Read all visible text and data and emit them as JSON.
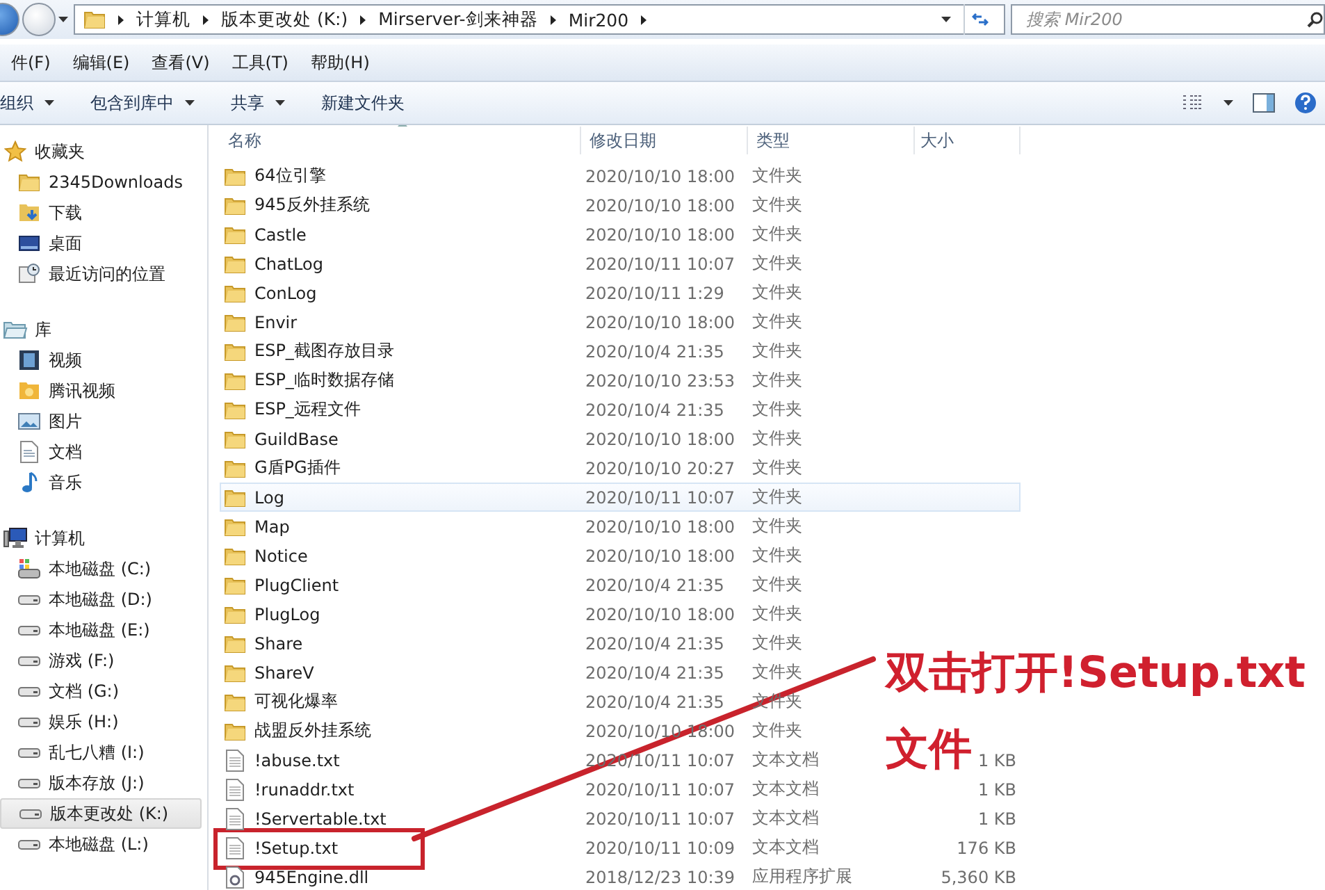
{
  "address_bar": {
    "breadcrumbs": [
      "计算机",
      "版本更改处 (K:)",
      "Mirserver-剑来神器",
      "Mir200"
    ],
    "search": {
      "placeholder": "搜索 Mir200"
    }
  },
  "menu_bar": [
    "件(F)",
    "编辑(E)",
    "查看(V)",
    "工具(T)",
    "帮助(H)"
  ],
  "toolbar": [
    "组织",
    "包含到库中",
    "共享",
    "新建文件夹"
  ],
  "sidebar": [
    {
      "label": "收藏夹",
      "kind": "star",
      "items": [
        {
          "label": "2345Downloads",
          "kind": "folder",
          "selected": false
        },
        {
          "label": "下载",
          "kind": "download",
          "selected": false
        },
        {
          "label": "桌面",
          "kind": "desktop",
          "selected": false
        },
        {
          "label": "最近访问的位置",
          "kind": "recent",
          "selected": false
        }
      ]
    },
    {
      "label": "库",
      "kind": "library",
      "items": [
        {
          "label": "视频",
          "kind": "video",
          "selected": false
        },
        {
          "label": "腾讯视频",
          "kind": "tencent",
          "selected": false
        },
        {
          "label": "图片",
          "kind": "image",
          "selected": false
        },
        {
          "label": "文档",
          "kind": "doc",
          "selected": false
        },
        {
          "label": "音乐",
          "kind": "music",
          "selected": false
        }
      ]
    },
    {
      "label": "计算机",
      "kind": "computer",
      "items": [
        {
          "label": "本地磁盘 (C:)",
          "kind": "sysdrive",
          "selected": false
        },
        {
          "label": "本地磁盘 (D:)",
          "kind": "drive",
          "selected": false
        },
        {
          "label": "本地磁盘 (E:)",
          "kind": "drive",
          "selected": false
        },
        {
          "label": "游戏 (F:)",
          "kind": "drive",
          "selected": false
        },
        {
          "label": "文档 (G:)",
          "kind": "drive",
          "selected": false
        },
        {
          "label": "娱乐 (H:)",
          "kind": "drive",
          "selected": false
        },
        {
          "label": "乱七八糟 (I:)",
          "kind": "drive",
          "selected": false
        },
        {
          "label": "版本存放 (J:)",
          "kind": "drive",
          "selected": false
        },
        {
          "label": "版本更改处 (K:)",
          "kind": "drive",
          "selected": true
        },
        {
          "label": "本地磁盘 (L:)",
          "kind": "drive",
          "selected": false
        }
      ]
    }
  ],
  "table": {
    "columns": [
      "名称",
      "修改日期",
      "类型",
      "大小"
    ],
    "rows": [
      {
        "name": "64位引擎",
        "date": "2020/10/10 18:00",
        "type": "文件夹",
        "kind": "folder",
        "selected": false
      },
      {
        "name": "945反外挂系统",
        "date": "2020/10/10 18:00",
        "type": "文件夹",
        "kind": "folder",
        "selected": false
      },
      {
        "name": "Castle",
        "date": "2020/10/10 18:00",
        "type": "文件夹",
        "kind": "folder",
        "selected": false
      },
      {
        "name": "ChatLog",
        "date": "2020/10/11 10:07",
        "type": "文件夹",
        "kind": "folder",
        "selected": false
      },
      {
        "name": "ConLog",
        "date": "2020/10/11 1:29",
        "type": "文件夹",
        "kind": "folder",
        "selected": false
      },
      {
        "name": "Envir",
        "date": "2020/10/10 18:00",
        "type": "文件夹",
        "kind": "folder",
        "selected": false
      },
      {
        "name": "ESP_截图存放目录",
        "date": "2020/10/4 21:35",
        "type": "文件夹",
        "kind": "folder",
        "selected": false
      },
      {
        "name": "ESP_临时数据存储",
        "date": "2020/10/10 23:53",
        "type": "文件夹",
        "kind": "folder",
        "selected": false
      },
      {
        "name": "ESP_远程文件",
        "date": "2020/10/4 21:35",
        "type": "文件夹",
        "kind": "folder",
        "selected": false
      },
      {
        "name": "GuildBase",
        "date": "2020/10/10 18:00",
        "type": "文件夹",
        "kind": "folder",
        "selected": false
      },
      {
        "name": "G盾PG插件",
        "date": "2020/10/10 20:27",
        "type": "文件夹",
        "kind": "folder",
        "selected": false
      },
      {
        "name": "Log",
        "date": "2020/10/11 10:07",
        "type": "文件夹",
        "kind": "folder",
        "selected": true
      },
      {
        "name": "Map",
        "date": "2020/10/10 18:00",
        "type": "文件夹",
        "kind": "folder",
        "selected": false
      },
      {
        "name": "Notice",
        "date": "2020/10/10 18:00",
        "type": "文件夹",
        "kind": "folder",
        "selected": false
      },
      {
        "name": "PlugClient",
        "date": "2020/10/4 21:35",
        "type": "文件夹",
        "kind": "folder",
        "selected": false
      },
      {
        "name": "PlugLog",
        "date": "2020/10/10 18:00",
        "type": "文件夹",
        "kind": "folder",
        "selected": false
      },
      {
        "name": "Share",
        "date": "2020/10/4 21:35",
        "type": "文件夹",
        "kind": "folder",
        "selected": false
      },
      {
        "name": "ShareV",
        "date": "2020/10/4 21:35",
        "type": "文件夹",
        "kind": "folder",
        "selected": false
      },
      {
        "name": "可视化爆率",
        "date": "2020/10/4 21:35",
        "type": "文件夹",
        "kind": "folder",
        "selected": false
      },
      {
        "name": "战盟反外挂系统",
        "date": "2020/10/10 18:00",
        "type": "文件夹",
        "kind": "folder",
        "selected": false
      },
      {
        "name": "!abuse.txt",
        "date": "2020/10/11 10:07",
        "type": "文本文档",
        "size": "1 KB",
        "kind": "text",
        "selected": false
      },
      {
        "name": "!runaddr.txt",
        "date": "2020/10/11 10:07",
        "type": "文本文档",
        "size": "1 KB",
        "kind": "text",
        "selected": false
      },
      {
        "name": "!Servertable.txt",
        "date": "2020/10/11 10:07",
        "type": "文本文档",
        "size": "1 KB",
        "kind": "text",
        "selected": false
      },
      {
        "name": "!Setup.txt",
        "date": "2020/10/11 10:09",
        "type": "文本文档",
        "size": "176 KB",
        "kind": "text",
        "selected": false
      },
      {
        "name": "945Engine.dll",
        "date": "2018/12/23 10:39",
        "type": "应用程序扩展",
        "size": "5,360 KB",
        "kind": "dll",
        "selected": false
      }
    ]
  },
  "annotation": {
    "lines": [
      "双击打开!Setup.txt",
      "文件"
    ]
  }
}
